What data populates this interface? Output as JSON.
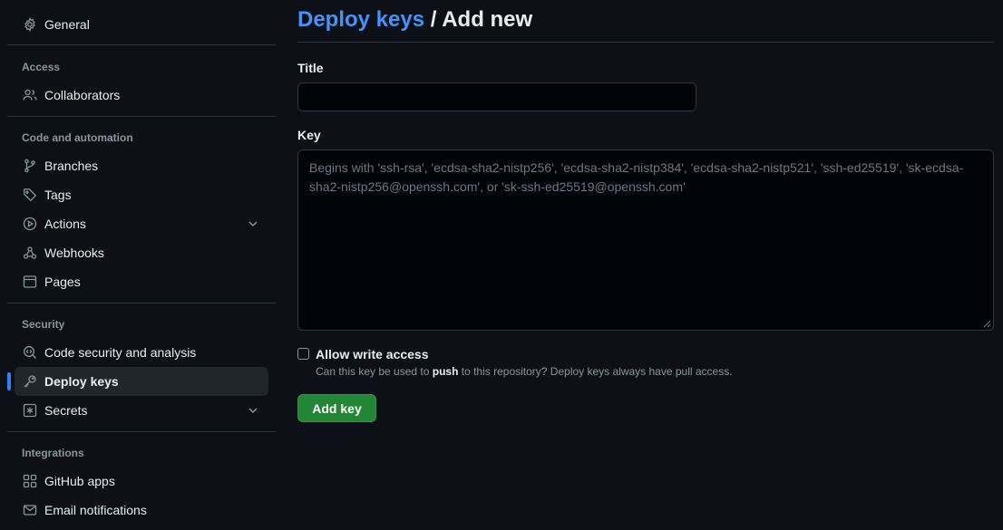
{
  "sidebar": {
    "general": "General",
    "access_heading": "Access",
    "collaborators": "Collaborators",
    "code_heading": "Code and automation",
    "branches": "Branches",
    "tags": "Tags",
    "actions": "Actions",
    "webhooks": "Webhooks",
    "pages": "Pages",
    "security_heading": "Security",
    "code_security": "Code security and analysis",
    "deploy_keys": "Deploy keys",
    "secrets": "Secrets",
    "integrations_heading": "Integrations",
    "github_apps": "GitHub apps",
    "email_notifications": "Email notifications"
  },
  "header": {
    "breadcrumb_link": "Deploy keys",
    "breadcrumb_separator": " / ",
    "breadcrumb_current": "Add new"
  },
  "form": {
    "title_label": "Title",
    "title_value": "",
    "key_label": "Key",
    "key_value": "",
    "key_placeholder": "Begins with 'ssh-rsa', 'ecdsa-sha2-nistp256', 'ecdsa-sha2-nistp384', 'ecdsa-sha2-nistp521', 'ssh-ed25519', 'sk-ecdsa-sha2-nistp256@openssh.com', or 'sk-ssh-ed25519@openssh.com'",
    "write_access_label": "Allow write access",
    "write_access_note_before": "Can this key be used to ",
    "write_access_note_bold": "push",
    "write_access_note_after": " to this repository? Deploy keys always have pull access.",
    "write_access_checked": false,
    "submit_label": "Add key"
  },
  "icons": {
    "general": "gear-icon",
    "collaborators": "people-icon",
    "branches": "git-branch-icon",
    "tags": "tag-icon",
    "actions": "play-icon",
    "webhooks": "webhook-icon",
    "pages": "browser-icon",
    "code_security": "codescan-icon",
    "deploy_keys": "key-icon",
    "secrets": "asterisk-icon",
    "github_apps": "apps-icon",
    "email_notifications": "mail-icon",
    "expand": "chevron-down-icon"
  },
  "colors": {
    "background": "#0d1117",
    "link": "#4493f8",
    "accent": "#2f81f7",
    "primary_button": "#238636",
    "muted_text": "#8b949e",
    "border": "#30363d"
  }
}
